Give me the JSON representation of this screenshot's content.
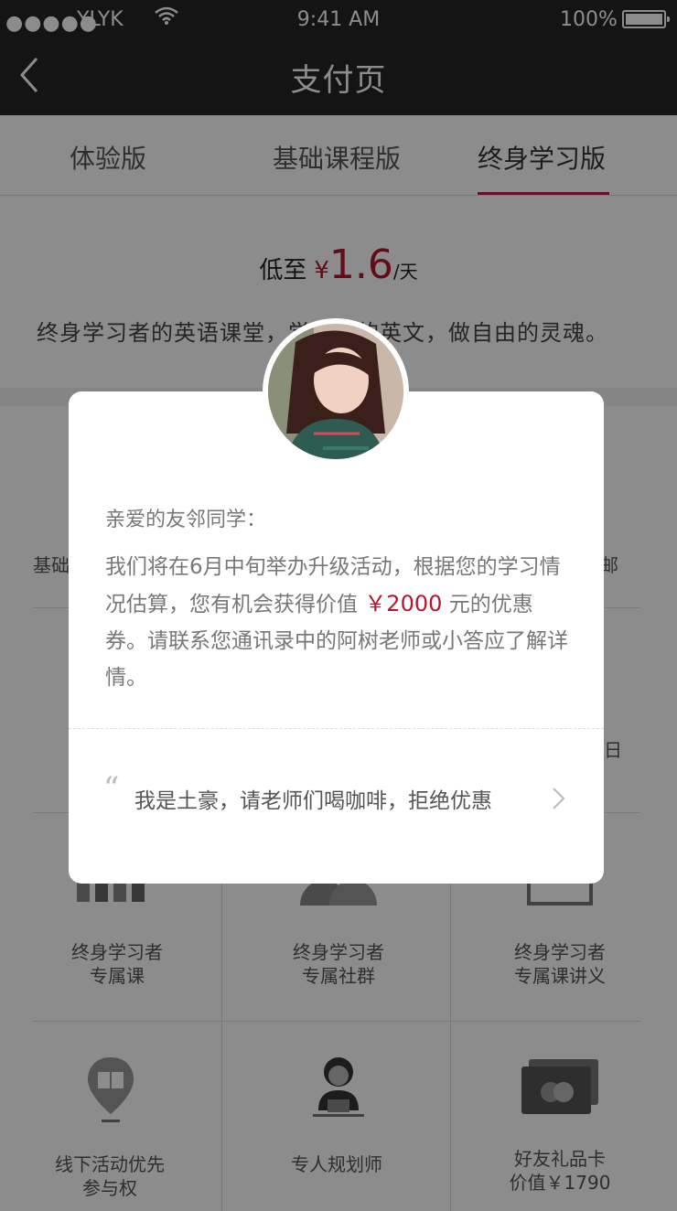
{
  "status": {
    "signal": "●●●●●",
    "carrier": "YLYK",
    "time": "9:41 AM",
    "battery": "100%"
  },
  "nav": {
    "title": "支付页"
  },
  "tabs": [
    {
      "label": "体验版"
    },
    {
      "label": "基础课程版"
    },
    {
      "label": "终身学习版"
    }
  ],
  "price": {
    "label": "低至",
    "currency": "¥",
    "amount": "1.6",
    "unit": "/天"
  },
  "slogan": "终身学习者的英语课堂，学……的英文，做自由的灵魂。",
  "partial_labels": {
    "left": "基础",
    "right": "邮",
    "right2": "日"
  },
  "benefits": [
    {
      "line1": "终身学习者",
      "line2": "专属课"
    },
    {
      "line1": "终身学习者",
      "line2": "专属社群"
    },
    {
      "line1": "终身学习者",
      "line2": "专属课讲义"
    },
    {
      "line1": "线下活动优先",
      "line2": "参与权"
    },
    {
      "line1": "专人规划师",
      "line2": ""
    },
    {
      "line1": "好友礼品卡",
      "line2": "价值￥1790"
    }
  ],
  "modal": {
    "greeting": "亲爱的友邻同学：",
    "msg_part1": "我们将在6月中旬举办升级活动，根据您的学习情况估算，您有机会获得价值",
    "msg_amount": "￥2000",
    "msg_part2": "元的优惠券。请联系您通讯录中的阿树老师或小答应了解详情。",
    "quote": "“",
    "refuse": "我是土豪，请老师们喝咖啡，拒绝优惠"
  },
  "colors": {
    "accent": "#b5172f",
    "tab_underline": "#c2185b",
    "navbar": "#252525"
  }
}
